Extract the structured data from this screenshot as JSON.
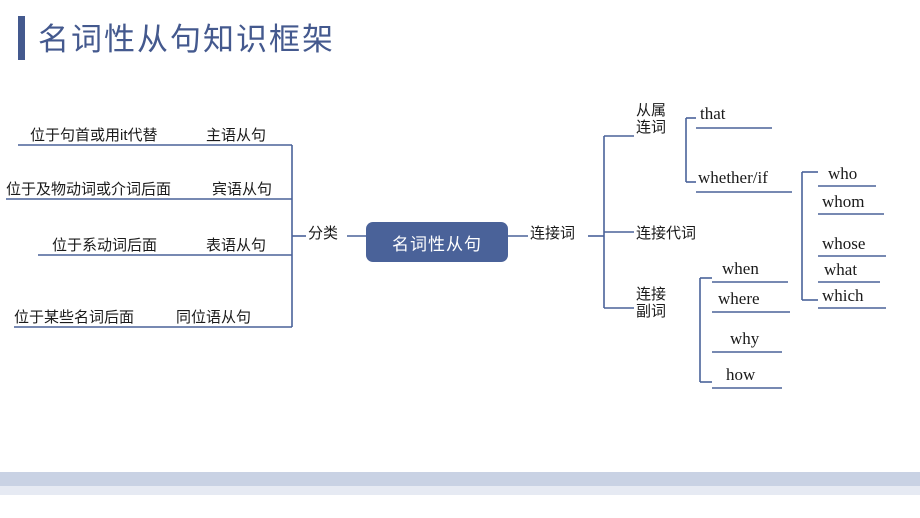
{
  "title": "名词性从句知识框架",
  "center": {
    "label": "名词性从句"
  },
  "branches": {
    "left": {
      "connector_label": "分类",
      "items": [
        {
          "desc": "位于句首或用it代替",
          "type": "主语从句"
        },
        {
          "desc": "位于及物动词或介词后面",
          "type": "宾语从句"
        },
        {
          "desc": "位于系动词后面",
          "type": "表语从句"
        },
        {
          "desc": "位于某些名词后面",
          "type": "同位语从句"
        }
      ]
    },
    "right": {
      "connector_label": "连接词",
      "groups": [
        {
          "name": "从属\n连词",
          "items": [
            "that",
            "whether/if"
          ]
        },
        {
          "name": "连接代词",
          "items": [
            "who",
            "whom",
            "whose",
            "what",
            "which"
          ]
        },
        {
          "name": "连接\n副词",
          "items": [
            "when",
            "where",
            "why",
            "how"
          ]
        }
      ]
    }
  },
  "colors": {
    "accent": "#44598e",
    "node_fill": "#4a6299",
    "line": "#4a6299",
    "band_top": "#c9d2e4",
    "band_bottom": "#e6eaf3"
  }
}
